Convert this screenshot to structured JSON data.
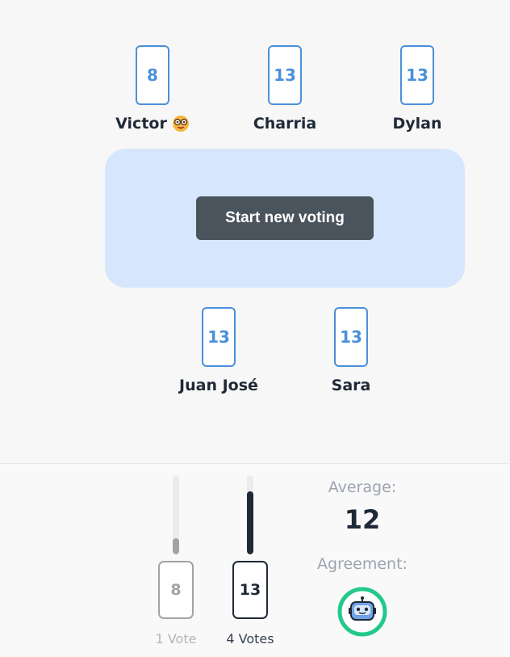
{
  "players_top": [
    {
      "name": "Victor",
      "vote": "8",
      "emoji": "nerd-face-icon"
    },
    {
      "name": "Charria",
      "vote": "13"
    },
    {
      "name": "Dylan",
      "vote": "13"
    }
  ],
  "table": {
    "button_label": "Start new voting"
  },
  "players_bottom": [
    {
      "name": "Juan José",
      "vote": "13"
    },
    {
      "name": "Sara",
      "vote": "13"
    }
  ],
  "results": {
    "columns": [
      {
        "card": "8",
        "votes_label": "1 Vote",
        "votes": 1,
        "fraction": 0.2,
        "color": "#a3a3a3"
      },
      {
        "card": "13",
        "votes_label": "4 Votes",
        "votes": 4,
        "fraction": 0.8,
        "color": "#1f2937"
      }
    ],
    "average_label": "Average:",
    "average_value": "12",
    "agreement_label": "Agreement:",
    "agreement_icon": "robot-icon",
    "agreement_color": "#22c98b"
  },
  "colors": {
    "card_accent": "#4a90d9",
    "table_bg": "#d6e7fd",
    "button_bg": "#4a545d"
  }
}
